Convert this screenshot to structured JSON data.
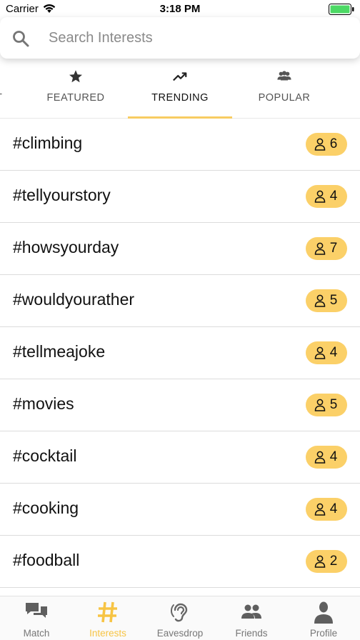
{
  "status_bar": {
    "carrier": "Carrier",
    "time": "3:18 PM",
    "battery_color": "#4cd964"
  },
  "search": {
    "placeholder": "Search Interests",
    "value": "",
    "icon": "search-icon"
  },
  "tabs": [
    {
      "label": "T",
      "icon": "",
      "active": false
    },
    {
      "label": "FEATURED",
      "icon": "star-icon",
      "active": false
    },
    {
      "label": "TRENDING",
      "icon": "trending-up-icon",
      "active": true
    },
    {
      "label": "POPULAR",
      "icon": "group-icon",
      "active": false
    }
  ],
  "accent_color": "#fbd068",
  "interests": [
    {
      "tag": "#climbing",
      "count": "6"
    },
    {
      "tag": "#tellyourstory",
      "count": "4"
    },
    {
      "tag": "#howsyourday",
      "count": "7"
    },
    {
      "tag": "#wouldyourather",
      "count": "5"
    },
    {
      "tag": "#tellmeajoke",
      "count": "4"
    },
    {
      "tag": "#movies",
      "count": "5"
    },
    {
      "tag": "#cocktail",
      "count": "4"
    },
    {
      "tag": "#cooking",
      "count": "4"
    },
    {
      "tag": "#foodball",
      "count": "2"
    }
  ],
  "bottom_nav": [
    {
      "label": "Match",
      "icon": "chat-bubbles-icon",
      "active": false
    },
    {
      "label": "Interests",
      "icon": "hashtag-icon",
      "active": true
    },
    {
      "label": "Eavesdrop",
      "icon": "ear-icon",
      "active": false
    },
    {
      "label": "Friends",
      "icon": "people-icon",
      "active": false
    },
    {
      "label": "Profile",
      "icon": "person-icon",
      "active": false
    }
  ]
}
